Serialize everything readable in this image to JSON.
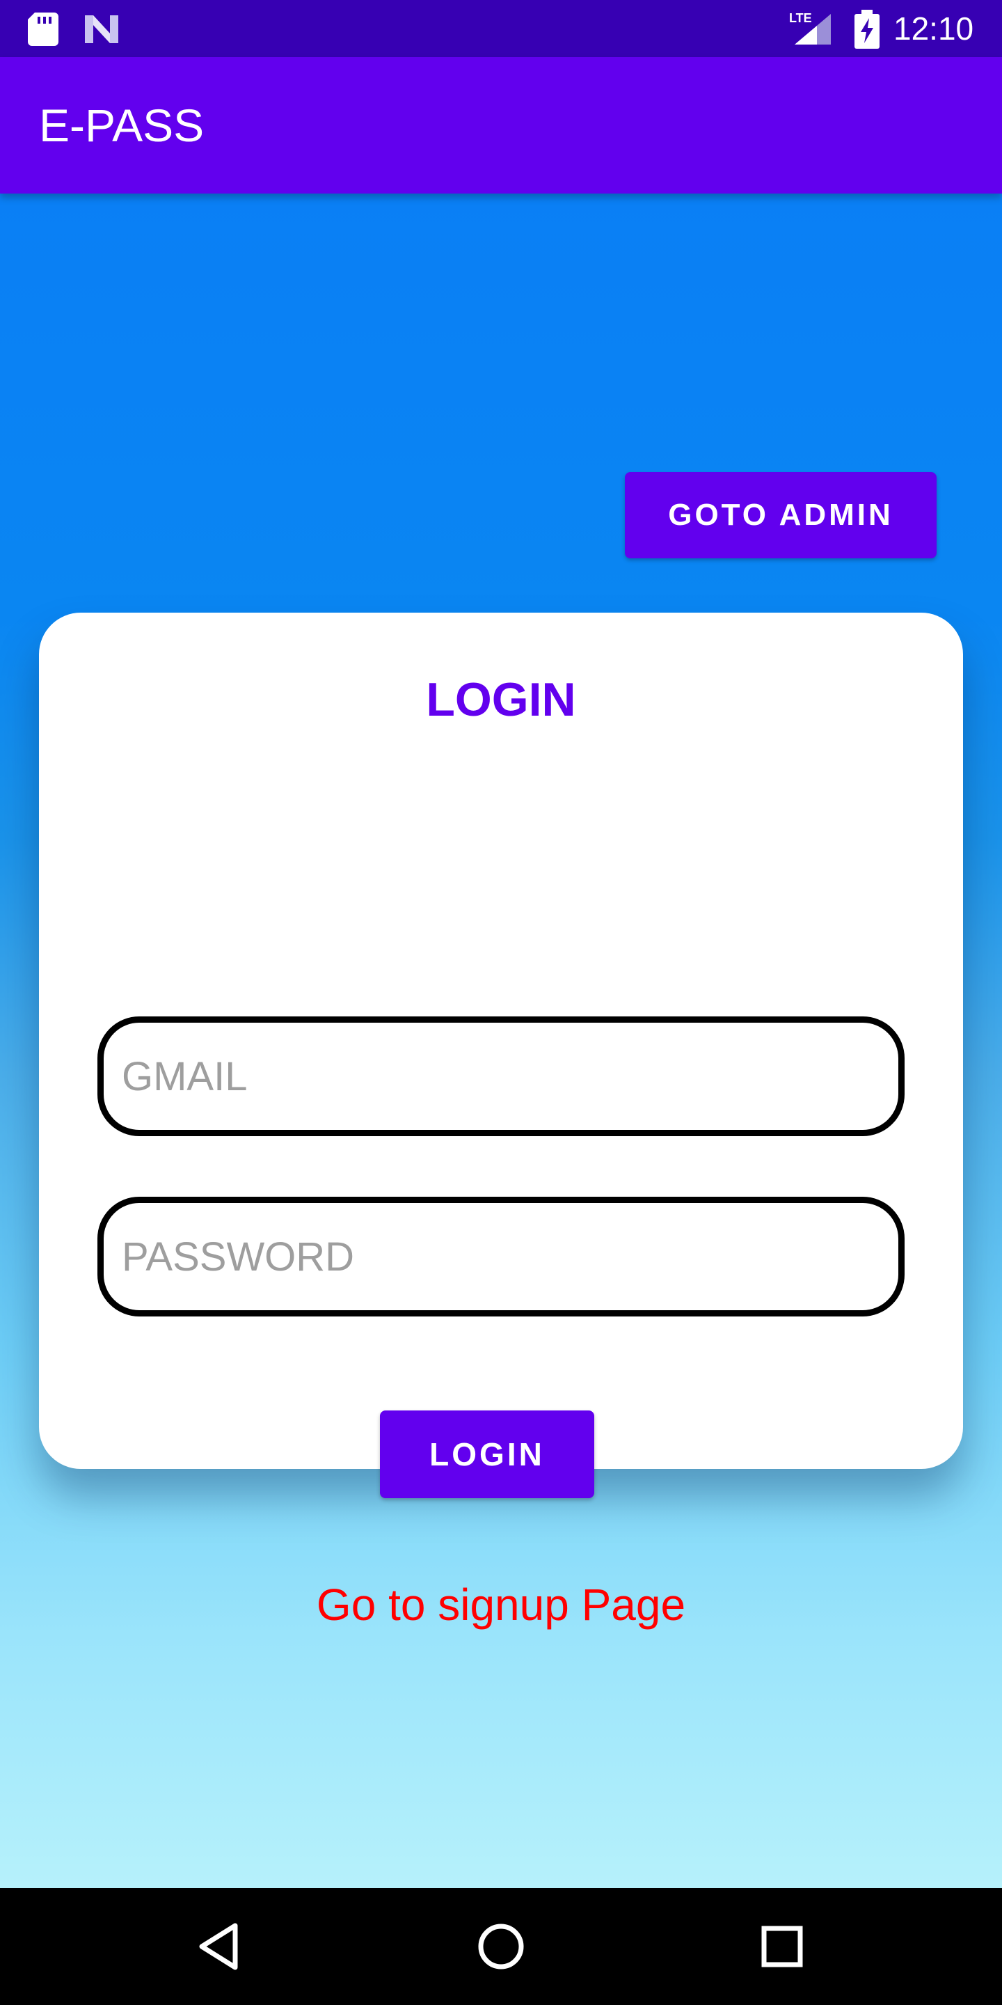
{
  "status_bar": {
    "time": "12:10",
    "network": "LTE",
    "icons": [
      "sd-card-icon",
      "n-notification-icon",
      "lte-signal-icon",
      "battery-charging-icon"
    ]
  },
  "app_bar": {
    "title": "E-PASS"
  },
  "main": {
    "goto_admin_label": "GOTO ADMIN",
    "login_card": {
      "title": "LOGIN",
      "gmail_placeholder": "GMAIL",
      "gmail_value": "",
      "password_placeholder": "PASSWORD",
      "password_value": "",
      "login_label": "LOGIN",
      "signup_link": "Go to signup Page"
    }
  },
  "nav_bar": {
    "icons": [
      "back-icon",
      "home-icon",
      "recents-icon"
    ]
  },
  "colors": {
    "primary": "#6200EE",
    "primary_dark": "#3700B3",
    "link_red": "#FF0000",
    "gradient_top": "#0A7FF5",
    "gradient_bottom": "#B6F1FB"
  }
}
